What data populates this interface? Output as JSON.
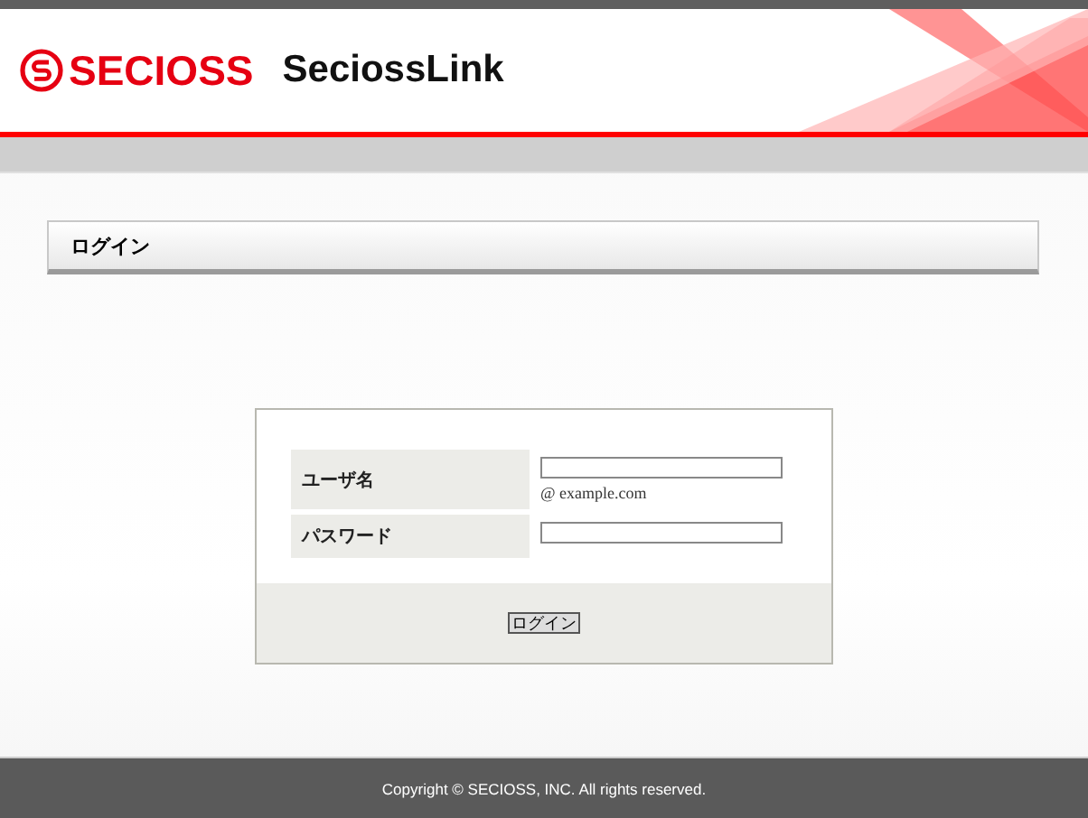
{
  "header": {
    "logo_text": "SECIOSS",
    "app_name": "SeciossLink"
  },
  "panel": {
    "title": "ログイン"
  },
  "form": {
    "fields": [
      {
        "label": "ユーザ名",
        "hint": "@ example.com",
        "kind": "text"
      },
      {
        "label": "パスワード",
        "kind": "password"
      }
    ],
    "submit": "ログイン"
  },
  "footer": {
    "copyright": "Copyright © SECIOSS, INC. All rights reserved."
  }
}
